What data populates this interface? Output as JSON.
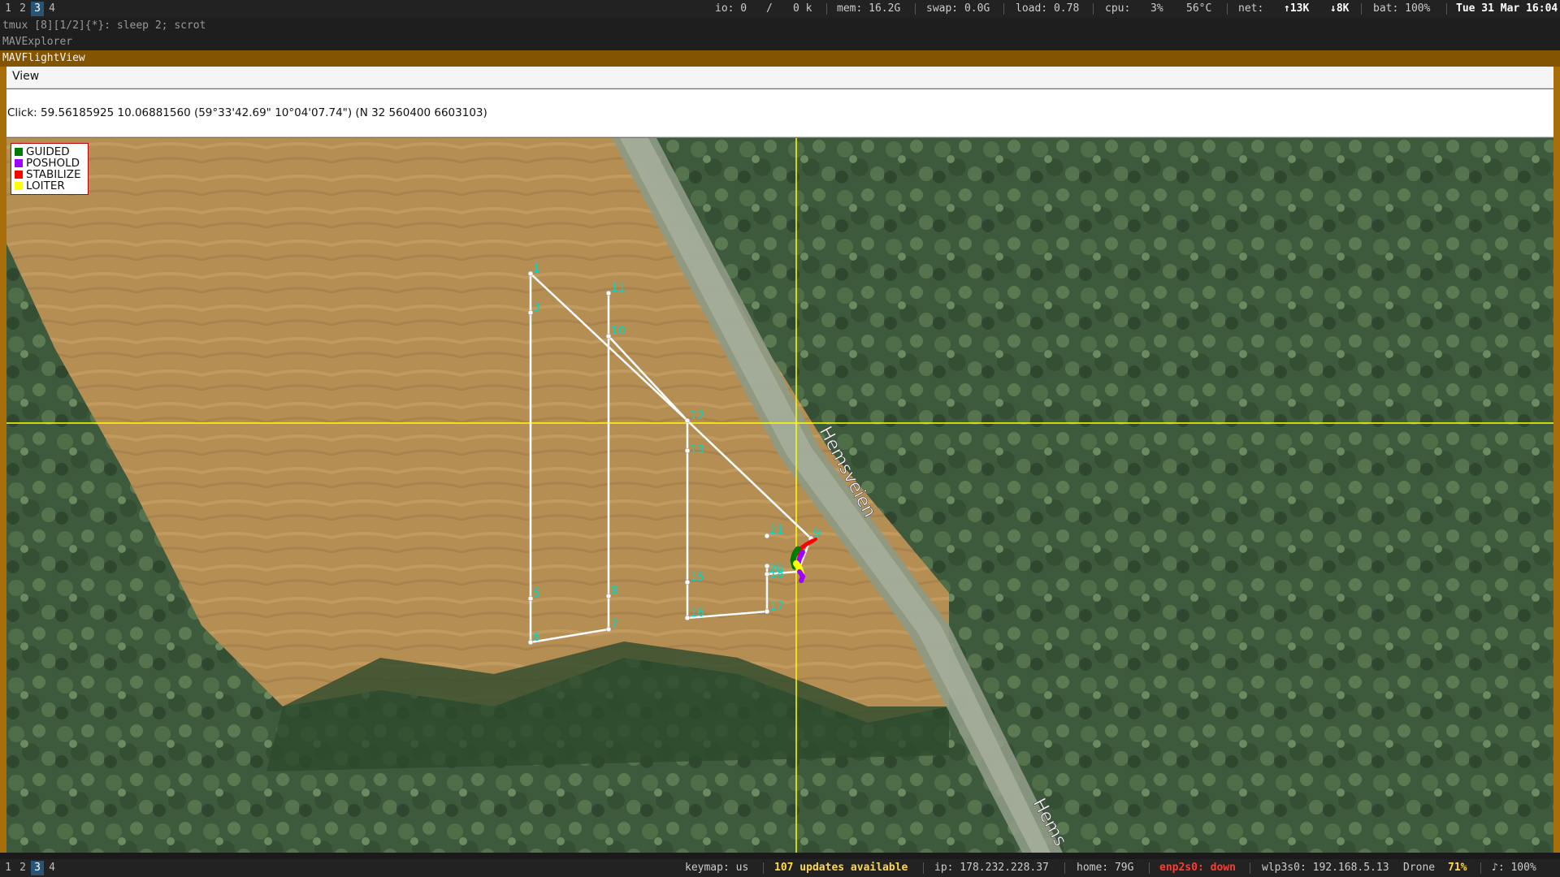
{
  "top_status": {
    "workspaces": [
      "1",
      "2",
      "3",
      "4"
    ],
    "active_workspace": "3",
    "io_label": "io: 0",
    "io_sep": "/",
    "io_k": "0 k",
    "mem": "mem: 16.2G",
    "swap": "swap: 0.0G",
    "load": "load: 0.78",
    "cpu_label": "cpu:",
    "cpu_val": "3%",
    "temp": "56°C",
    "net_label": "net:",
    "net_up": "↑13K",
    "net_down": "↓8K",
    "bat": "bat: 100%",
    "datetime": "Tue 31 Mar 16:04"
  },
  "windows": {
    "tmux_title": "tmux [8][1/2]{*}:  sleep 2; scrot",
    "explorer_title": "MAVExplorer",
    "flightview_title": "MAVFlightView"
  },
  "menu": {
    "view": "View"
  },
  "click_info": "Click: 59.56185925 10.06881560 (59°33'42.69\" 10°04'07.74\") (N 32 560400 6603103)",
  "legend": [
    {
      "label": "GUIDED",
      "color": "#007a00"
    },
    {
      "label": "POSHOLD",
      "color": "#a000ff"
    },
    {
      "label": "STABILIZE",
      "color": "#ff0000"
    },
    {
      "label": "LOITER",
      "color": "#ffff00"
    }
  ],
  "map": {
    "road_label_1": "Hemsveien",
    "road_label_2": "Hems",
    "waypoints": [
      "1",
      "3",
      "5",
      "6",
      "7",
      "8",
      "9",
      "10",
      "11",
      "12",
      "13",
      "15",
      "16",
      "17",
      "18",
      "20",
      "21"
    ],
    "colors": {
      "path": "#ffffff",
      "waypoint_label": "#00d8c8",
      "crosshair": "#ffff00"
    }
  },
  "bottom_status": {
    "workspaces": [
      "1",
      "2",
      "3",
      "4"
    ],
    "active_workspace": "3",
    "keymap": "keymap: us",
    "updates": "107 updates available",
    "ip": "ip: 178.232.228.37",
    "home": "home: 79G",
    "enp": "enp2s0: down",
    "wlp": "wlp3s0: 192.168.5.13",
    "drone": "Drone",
    "drone_pct": "71%",
    "volume": "♪: 100%"
  }
}
